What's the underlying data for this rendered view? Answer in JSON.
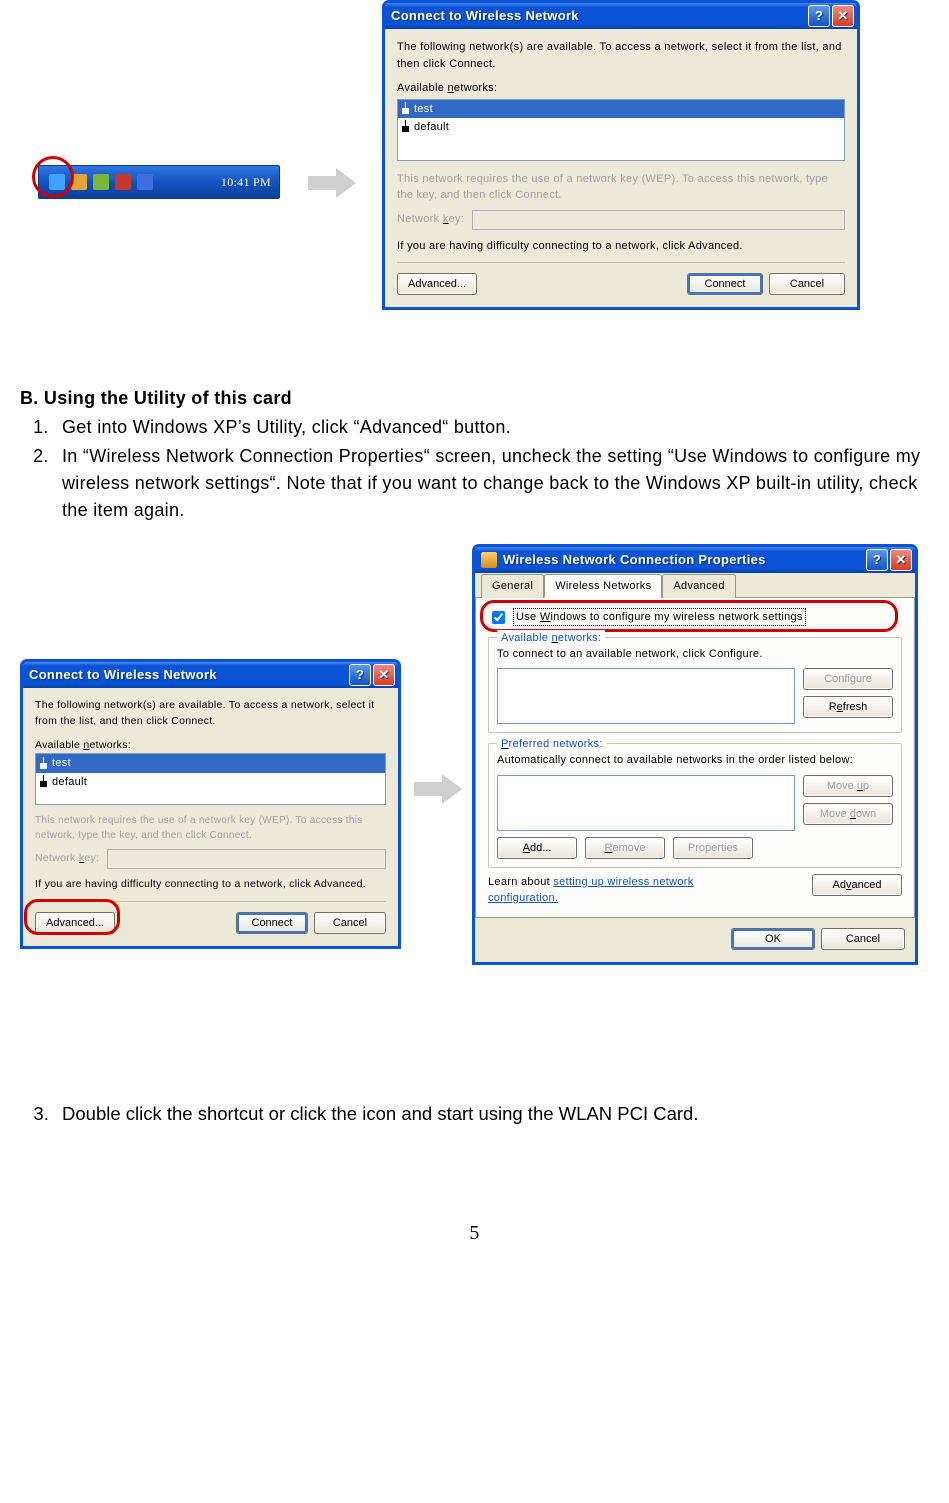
{
  "taskbar": {
    "time": "10:41 PM"
  },
  "dialog_connect": {
    "title": "Connect to Wireless Network",
    "intro": "The following network(s) are available. To access a network, select it from the list, and then click Connect.",
    "available_label": "Available networks:",
    "items": [
      "test",
      "default"
    ],
    "wep_note": "This network requires the use of a network key (WEP). To access this network, type the key, and then click Connect.",
    "key_label": "Network key:",
    "difficulty": "If you are having difficulty connecting to a network, click Advanced.",
    "btn_advanced": "Advanced...",
    "btn_connect": "Connect",
    "btn_cancel": "Cancel"
  },
  "dialog_props": {
    "title": "Wireless Network Connection Properties",
    "tabs": {
      "general": "General",
      "wireless": "Wireless Networks",
      "advanced": "Advanced"
    },
    "use_windows": "Use Windows to configure my wireless network settings",
    "group_available": {
      "label": "Available networks:",
      "hint": "To connect to an available network, click Configure.",
      "btn_configure": "Configure",
      "btn_refresh": "Refresh"
    },
    "group_preferred": {
      "label": "Preferred networks:",
      "hint": "Automatically connect to available networks in the order listed below:",
      "btn_moveup": "Move up",
      "btn_movedown": "Move down",
      "btn_add": "Add...",
      "btn_remove": "Remove",
      "btn_properties": "Properties"
    },
    "learn_prefix": "Learn about ",
    "learn_link": "setting up wireless network configuration.",
    "btn_advanced": "Advanced",
    "btn_ok": "OK",
    "btn_cancel": "Cancel"
  },
  "text": {
    "section_head": "B. Using the Utility of this card",
    "step1": "Get into Windows XP’s Utility, click “Advanced“ button.",
    "step2": "In “Wireless Network Connection Properties“ screen, uncheck the setting “Use Windows to configure my wireless network settings“. Note that if you want to change back to the Windows XP built-in utility, check the item again.",
    "step3": "Double click the shortcut or click the icon and start using the WLAN PCI Card.",
    "page_number": "5"
  }
}
